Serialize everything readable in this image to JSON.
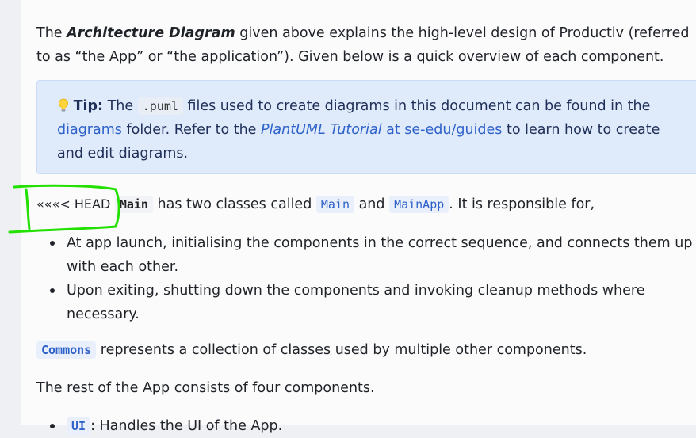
{
  "intro": {
    "prefix": "The ",
    "emph": "Architecture Diagram",
    "suffix": " given above explains the high-level design of Productiv (referred to as “the App” or “the application”). Given below is a quick overview of each component."
  },
  "tip": {
    "label": "Tip:",
    "t1": " The ",
    "code": ".puml",
    "t2": " files used to create diagrams in this document can be found in the ",
    "link1": "diagrams",
    "t3": " folder. Refer to the ",
    "link2": "PlantUML Tutorial",
    "link3": " at se-edu/guides",
    "t4": " to learn how to create and edit diagrams."
  },
  "main_para": {
    "conflict_marker": "«««< HEAD",
    "code_main_bold": "Main",
    "t1": " has two classes called ",
    "code_main": "Main",
    "t2": " and ",
    "code_mainapp": "MainApp",
    "t3": ". It is responsible for,"
  },
  "responsibilities": [
    "At app launch, initialising the components in the correct sequence, and connects them up with each other.",
    "Upon exiting, shutting down the components and invoking cleanup methods where necessary."
  ],
  "commons_para": {
    "code": "Commons",
    "text": " represents a collection of classes used by multiple other components."
  },
  "rest_para": "The rest of the App consists of four components.",
  "components": [
    {
      "code": "UI",
      "text": ": Handles the UI of the App."
    }
  ],
  "colors": {
    "tip_background": "#dfeafb",
    "link": "#2f62c9",
    "annotation": "#22e000"
  }
}
